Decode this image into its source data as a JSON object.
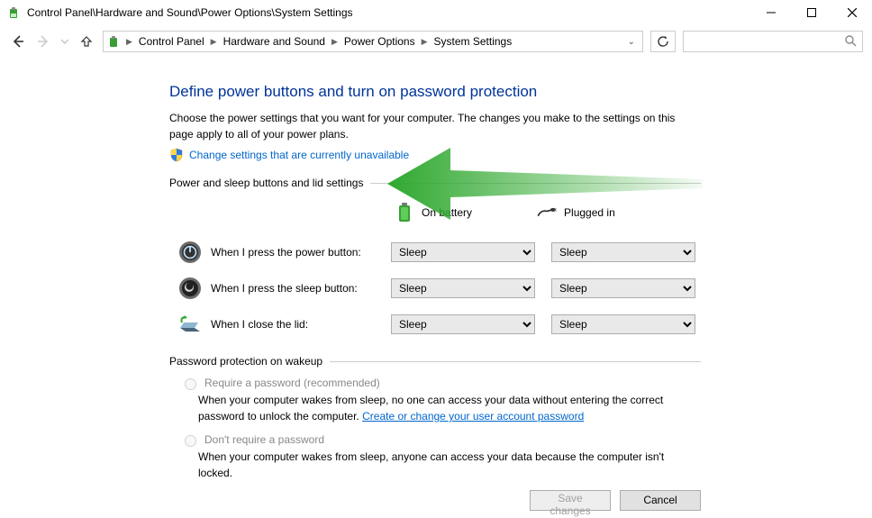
{
  "window": {
    "title": "Control Panel\\Hardware and Sound\\Power Options\\System Settings"
  },
  "breadcrumb": {
    "items": [
      "Control Panel",
      "Hardware and Sound",
      "Power Options",
      "System Settings"
    ]
  },
  "main": {
    "heading": "Define power buttons and turn on password protection",
    "description": "Choose the power settings that you want for your computer. The changes you make to the settings on this page apply to all of your power plans.",
    "change_link": "Change settings that are currently unavailable",
    "group1_label": "Power and sleep buttons and lid settings",
    "columns": {
      "battery": "On battery",
      "plugged": "Plugged in"
    },
    "rows": [
      {
        "label": "When I press the power button:",
        "battery": "Sleep",
        "plugged": "Sleep"
      },
      {
        "label": "When I press the sleep button:",
        "battery": "Sleep",
        "plugged": "Sleep"
      },
      {
        "label": "When I close the lid:",
        "battery": "Sleep",
        "plugged": "Sleep"
      }
    ],
    "group2_label": "Password protection on wakeup",
    "radio_require_label": "Require a password (recommended)",
    "radio_require_desc_a": "When your computer wakes from sleep, no one can access your data without entering the correct password to unlock the computer. ",
    "radio_require_link": "Create or change your user account password",
    "radio_dont_label": "Don't require a password",
    "radio_dont_desc": "When your computer wakes from sleep, anyone can access your data because the computer isn't locked."
  },
  "footer": {
    "save": "Save changes",
    "cancel": "Cancel"
  }
}
